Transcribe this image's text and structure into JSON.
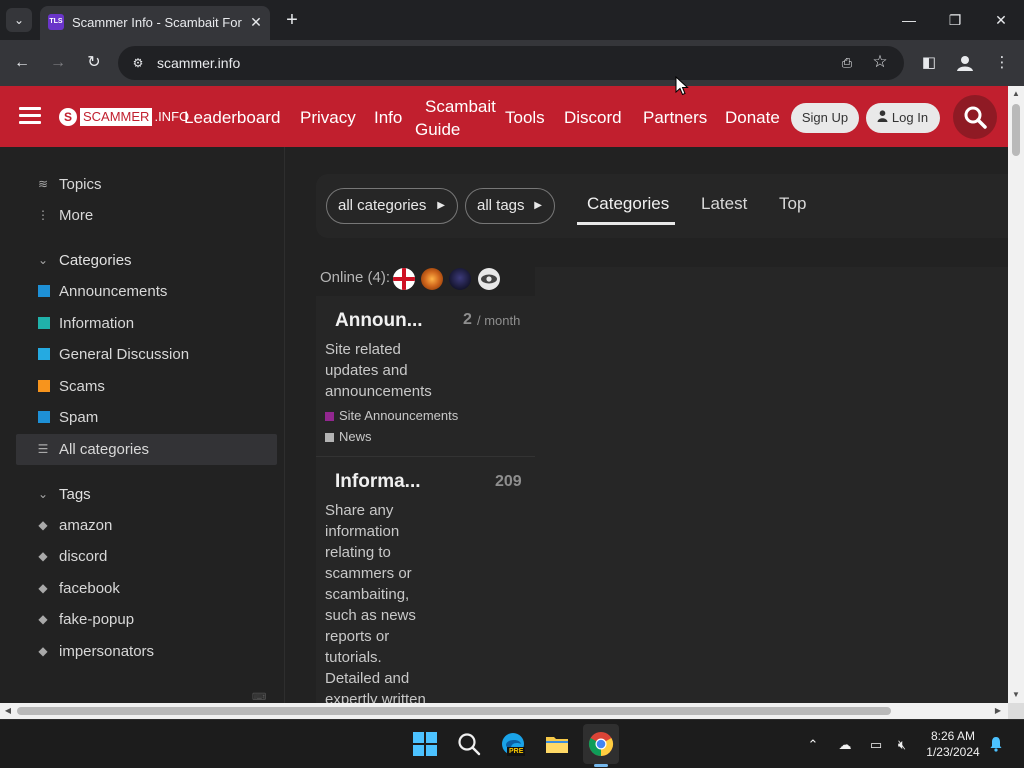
{
  "browser": {
    "tab_title": "Scammer Info - Scambait Forum",
    "favicon_text": "TLS",
    "url": "scammer.info",
    "icons": [
      "tab-dropdown-icon",
      "close-icon",
      "plus-icon",
      "minimize-icon",
      "restore-icon",
      "back-icon",
      "forward-icon",
      "reload-icon",
      "site-info-icon",
      "install-app-icon",
      "star-icon",
      "side-panel-icon",
      "profile-icon",
      "kebab-menu-icon"
    ]
  },
  "header": {
    "logo_mark": "S",
    "logo_scammer": "SCAMMER",
    "logo_info": ".INFO",
    "links": {
      "leaderboard": "Leaderboard",
      "privacy": "Privacy",
      "info": "Info",
      "scambait_1": "Scambait",
      "scambait_2": "Guide",
      "tools": "Tools",
      "discord": "Discord",
      "partners": "Partners",
      "donate": "Donate"
    },
    "signup": "Sign Up",
    "login": "Log In",
    "accent_color": "#c11f2e"
  },
  "sidebar": {
    "topics": "Topics",
    "more": "More",
    "categories_header": "Categories",
    "categories": [
      {
        "label": "Announcements",
        "color": "#1e90d6"
      },
      {
        "label": "Information",
        "color": "#20b2aa"
      },
      {
        "label": "General Discussion",
        "color": "#25aae1"
      },
      {
        "label": "Scams",
        "color": "#f7941d"
      },
      {
        "label": "Spam",
        "color": "#1e90d6"
      }
    ],
    "all_categories": "All categories",
    "tags_header": "Tags",
    "tags": [
      "amazon",
      "discord",
      "facebook",
      "fake-popup",
      "impersonators"
    ]
  },
  "main": {
    "filter_categories": "all categories",
    "filter_tags": "all tags",
    "tab_categories": "Categories",
    "tab_latest": "Latest",
    "tab_top": "Top",
    "online": "Online (4):",
    "cards": [
      {
        "title": "Announ...",
        "count": "2",
        "unit": "/ month",
        "desc_lines": [
          "Site related",
          "updates and",
          "announcements"
        ],
        "subcategories": [
          {
            "label": "Site Announcements",
            "color": "#92278f"
          },
          {
            "label": "News",
            "color": "#b3b3b3"
          }
        ]
      },
      {
        "title": "Informa...",
        "count": "209",
        "desc_lines": [
          "Share any",
          "information",
          "relating to",
          "scammers or",
          "scambaiting,",
          "such as news",
          "reports or",
          "tutorials.",
          "Detailed and",
          "expertly written"
        ]
      }
    ]
  },
  "taskbar": {
    "time": "8:26 AM",
    "date": "1/23/2024",
    "edge_badge": "PRE"
  }
}
